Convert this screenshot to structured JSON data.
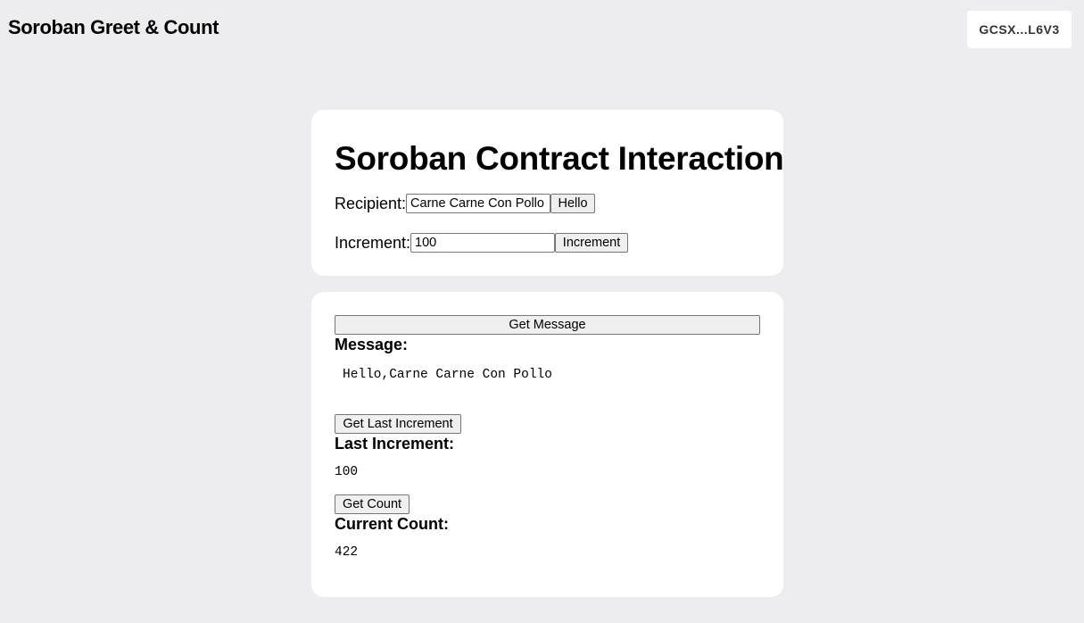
{
  "header": {
    "title": "Soroban Greet & Count",
    "wallet_label": "GCSX...L6V3"
  },
  "interaction_card": {
    "heading": "Soroban Contract Interaction",
    "recipient": {
      "label": "Recipient:",
      "value": "Carne Carne Con Pollo",
      "button_label": "Hello"
    },
    "increment": {
      "label": "Increment:",
      "value": "100",
      "button_label": "Increment"
    }
  },
  "results_card": {
    "get_message_label": "Get Message",
    "message_label": "Message:",
    "message_value": "Hello,Carne Carne Con Pollo",
    "get_last_increment_label": "Get Last Increment",
    "last_increment_label": "Last Increment:",
    "last_increment_value": "100",
    "get_count_label": "Get Count",
    "current_count_label": "Current Count:",
    "current_count_value": "422"
  }
}
